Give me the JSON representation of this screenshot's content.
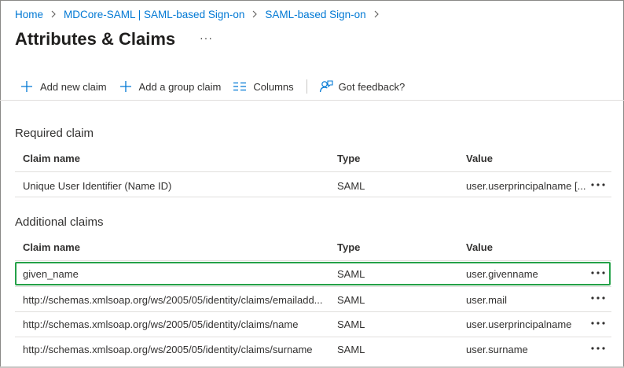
{
  "breadcrumb": {
    "items": [
      "Home",
      "MDCore-SAML | SAML-based Sign-on",
      "SAML-based Sign-on"
    ]
  },
  "page": {
    "title": "Attributes & Claims",
    "more": "···"
  },
  "toolbar": {
    "add_new_claim": "Add new claim",
    "add_group_claim": "Add a group claim",
    "columns": "Columns",
    "feedback": "Got feedback?"
  },
  "required": {
    "title": "Required claim",
    "headers": {
      "name": "Claim name",
      "type": "Type",
      "value": "Value"
    },
    "rows": [
      {
        "name": "Unique User Identifier (Name ID)",
        "type": "SAML",
        "value": "user.userprincipalname [..."
      }
    ]
  },
  "additional": {
    "title": "Additional claims",
    "headers": {
      "name": "Claim name",
      "type": "Type",
      "value": "Value"
    },
    "rows": [
      {
        "name": "given_name",
        "type": "SAML",
        "value": "user.givenname"
      },
      {
        "name": "http://schemas.xmlsoap.org/ws/2005/05/identity/claims/emailadd...",
        "type": "SAML",
        "value": "user.mail"
      },
      {
        "name": "http://schemas.xmlsoap.org/ws/2005/05/identity/claims/name",
        "type": "SAML",
        "value": "user.userprincipalname"
      },
      {
        "name": "http://schemas.xmlsoap.org/ws/2005/05/identity/claims/surname",
        "type": "SAML",
        "value": "user.surname"
      }
    ]
  },
  "colors": {
    "link": "#0078d4",
    "highlight": "#24a148",
    "text": "#323130"
  },
  "icons": [
    "chevron-right-icon",
    "plus-icon",
    "columns-icon",
    "feedback-icon",
    "more-icon"
  ]
}
